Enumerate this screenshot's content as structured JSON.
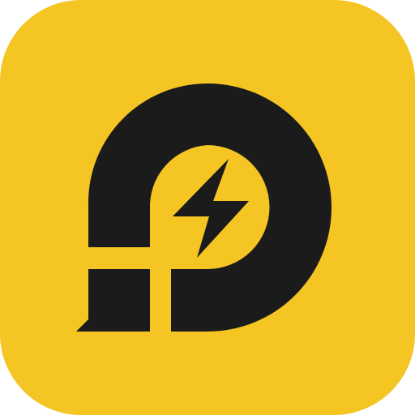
{
  "icon": {
    "name": "app-logo-icon",
    "background_color": "#F4C523",
    "mark_color": "#1B1B1B"
  }
}
